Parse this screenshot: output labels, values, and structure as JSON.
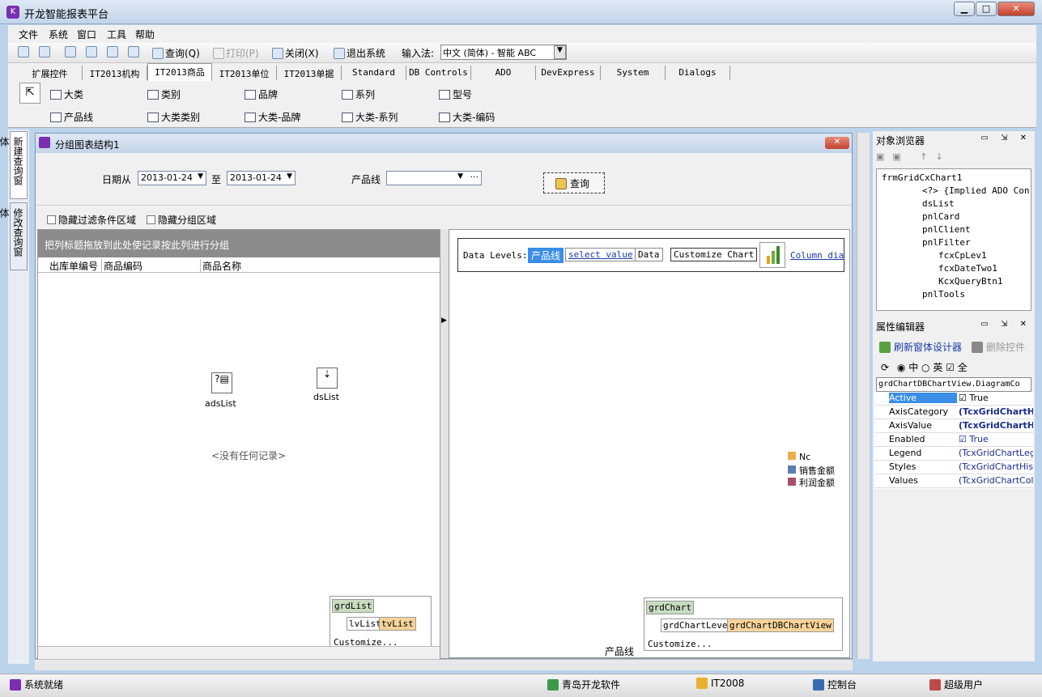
{
  "app": {
    "title": "开龙智能报表平台"
  },
  "menu": [
    "文件",
    "系统",
    "窗口",
    "工具",
    "帮助"
  ],
  "toolbar": {
    "query": "查询(Q)",
    "print": "打印(P)",
    "close": "关闭(X)",
    "exit": "退出系统",
    "ime_label": "输入法:",
    "ime_value": "中文 (简体) - 智能 ABC"
  },
  "palette": {
    "tabs": [
      "扩展控件",
      "IT2013机构",
      "IT2013商品",
      "IT2013单位",
      "IT2013单据",
      "Standard",
      "DB Controls",
      "ADO",
      "DevExpress",
      "System",
      "Dialogs"
    ],
    "row1": [
      "大类",
      "类别",
      "品牌",
      "系列",
      "型号"
    ],
    "row2": [
      "产品线",
      "大类类别",
      "大类-品牌",
      "大类-系列",
      "大类-编码"
    ]
  },
  "left_tabs": [
    "新建查询窗体",
    "修改查询窗体"
  ],
  "form": {
    "title": "分组图表结构1",
    "date_from_label": "日期从",
    "date_from": "2013-01-24",
    "to_label": "至",
    "date_to": "2013-01-24",
    "product_line_label": "产品线",
    "query_button": "查询",
    "hide_filter": "隐藏过滤条件区域",
    "hide_group": "隐藏分组区域"
  },
  "grid": {
    "group_hint": "把列标题拖放到此处使记录按此列进行分组",
    "columns": [
      "出库单编号",
      "商品编码",
      "商品名称"
    ],
    "empty_text": "<没有任何记录>",
    "components": [
      "adsList",
      "dsList"
    ],
    "level_name": "grdList",
    "views": [
      "lvList",
      "tvList"
    ],
    "customize": "Customize..."
  },
  "chart": {
    "data_levels_label": "Data Levels:",
    "level_value": "产品线",
    "select_value": "select value",
    "data_label": "Data",
    "customize_chart": "Customize Chart",
    "column_diag": "Column diag",
    "legend": [
      {
        "name": "Nc",
        "color": "#e8b04a"
      },
      {
        "name": "销售金额",
        "color": "#5a7fb5"
      },
      {
        "name": "利润金额",
        "color": "#a8506a"
      }
    ],
    "axis_label": "产品线",
    "level_name": "grdChart",
    "views": [
      "grdChartLevel",
      "grdChartDBChartView"
    ],
    "customize": "Customize..."
  },
  "object_browser": {
    "title": "对象浏览器",
    "tree": [
      "frmGridCxChart1",
      "<?> {Implied ADO Con",
      "dsList",
      "pnlCard",
      "pnlClient",
      "pnlFilter",
      "fcxCpLev1",
      "fcxDateTwo1",
      "KcxQueryBtn1",
      "pnlTools"
    ]
  },
  "property_editor": {
    "title": "属性编辑器",
    "refresh": "刷新窗体设计器",
    "delete": "删除控件",
    "lang_zh": "中",
    "lang_en": "英",
    "all": "全",
    "selected_object": "grdChartDBChartView.DiagramCo",
    "rows": [
      {
        "name": "Active",
        "value": "True"
      },
      {
        "name": "AxisCategory",
        "value": "(TcxGridChartHis"
      },
      {
        "name": "AxisValue",
        "value": "(TcxGridChartHis"
      },
      {
        "name": "Enabled",
        "value": "True"
      },
      {
        "name": "Legend",
        "value": "(TcxGridChartLeger"
      },
      {
        "name": "Styles",
        "value": "(TcxGridChartHistog"
      },
      {
        "name": "Values",
        "value": "(TcxGridChartColum"
      }
    ]
  },
  "status": {
    "ready": "系统就绪",
    "company": "青岛开龙软件",
    "db": "IT2008",
    "console": "控制台",
    "user": "超级用户"
  }
}
